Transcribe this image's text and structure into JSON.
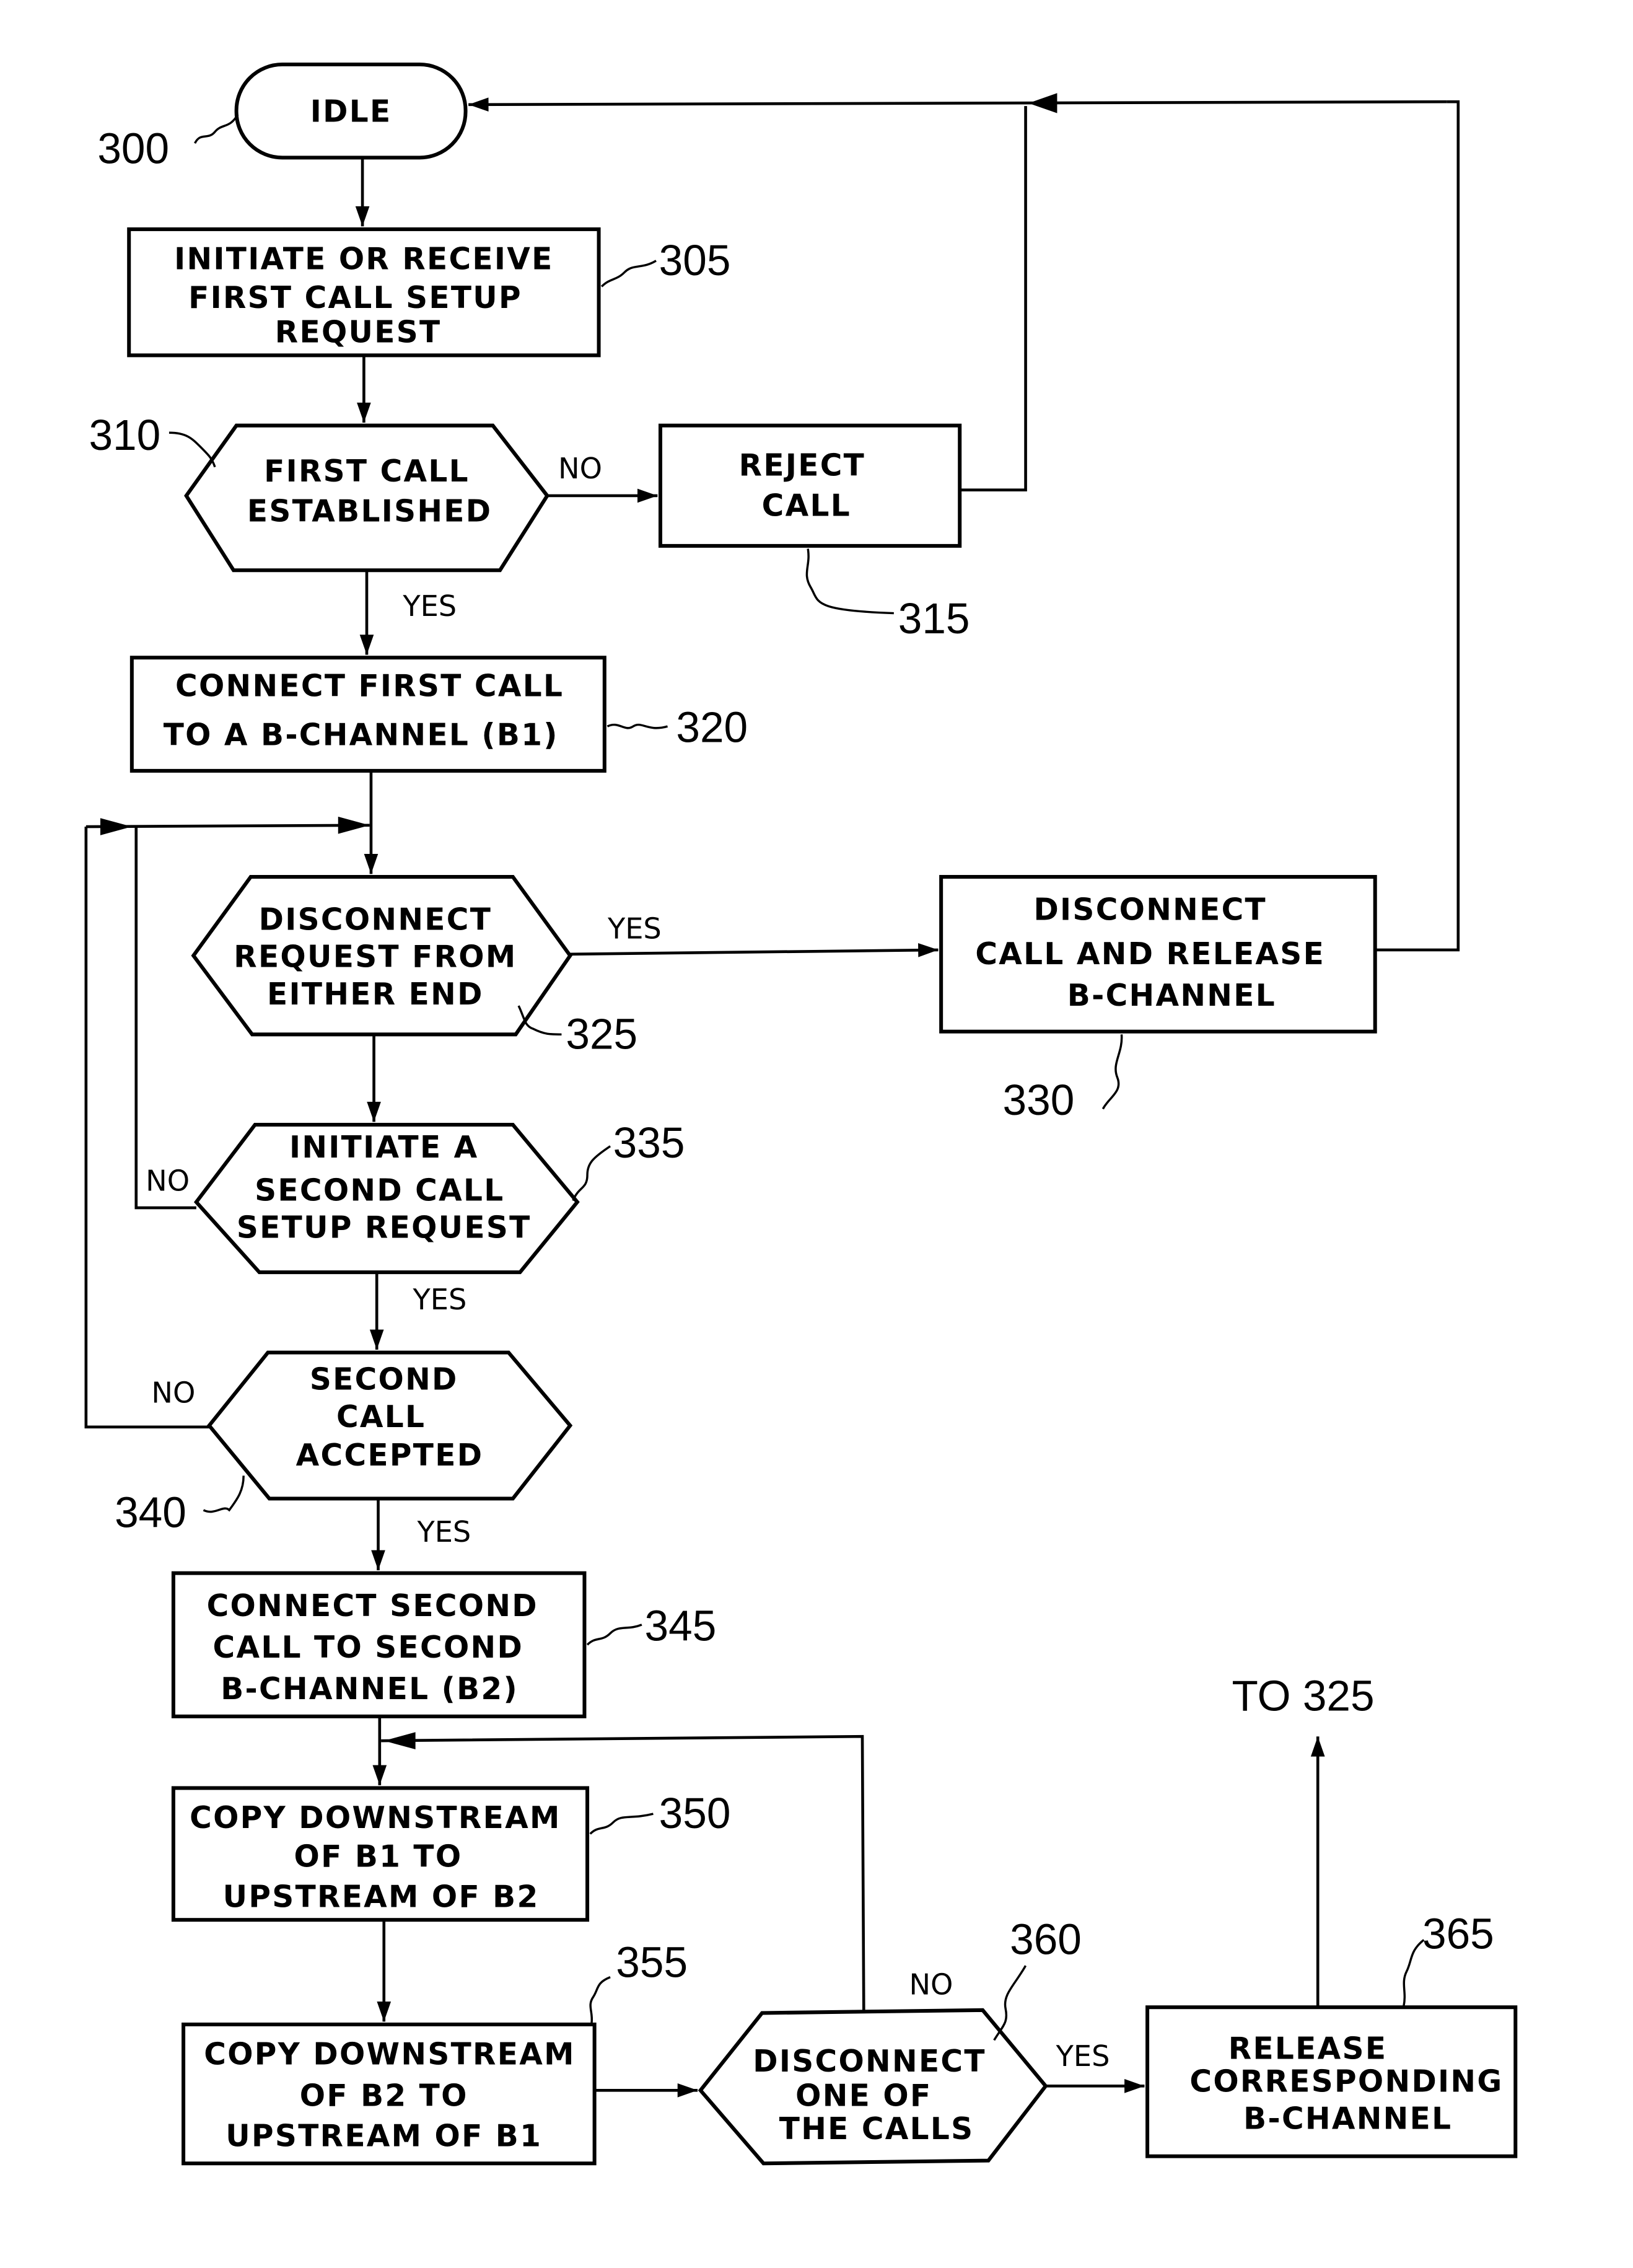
{
  "figure": {
    "type": "flowchart",
    "nodes": [
      {
        "id": "300",
        "shape": "terminal",
        "lines": [
          "IDLE"
        ],
        "ref": "300"
      },
      {
        "id": "305",
        "shape": "process",
        "lines": [
          "INITIATE OR RECEIVE",
          "FIRST CALL SETUP",
          "REQUEST"
        ],
        "ref": "305"
      },
      {
        "id": "310",
        "shape": "decision",
        "lines": [
          "FIRST CALL",
          "ESTABLISHED"
        ],
        "ref": "310"
      },
      {
        "id": "315",
        "shape": "process",
        "lines": [
          "REJECT",
          "CALL"
        ],
        "ref": "315"
      },
      {
        "id": "320",
        "shape": "process",
        "lines": [
          "CONNECT FIRST CALL",
          "TO A B-CHANNEL (B1)"
        ],
        "ref": "320"
      },
      {
        "id": "325",
        "shape": "decision",
        "lines": [
          "DISCONNECT",
          "REQUEST FROM",
          "EITHER END"
        ],
        "ref": "325"
      },
      {
        "id": "330",
        "shape": "process",
        "lines": [
          "DISCONNECT",
          "CALL AND RELEASE",
          "B-CHANNEL"
        ],
        "ref": "330"
      },
      {
        "id": "335",
        "shape": "decision",
        "lines": [
          "INITIATE A",
          "SECOND CALL",
          "SETUP REQUEST"
        ],
        "ref": "335"
      },
      {
        "id": "340",
        "shape": "decision",
        "lines": [
          "SECOND",
          "CALL",
          "ACCEPTED"
        ],
        "ref": "340"
      },
      {
        "id": "345",
        "shape": "process",
        "lines": [
          "CONNECT SECOND",
          "CALL TO SECOND",
          "B-CHANNEL (B2)"
        ],
        "ref": "345"
      },
      {
        "id": "350",
        "shape": "process",
        "lines": [
          "COPY DOWNSTREAM",
          "OF B1 TO",
          "UPSTREAM OF B2"
        ],
        "ref": "350"
      },
      {
        "id": "355",
        "shape": "process",
        "lines": [
          "COPY DOWNSTREAM",
          "OF B2 TO",
          "UPSTREAM OF B1"
        ],
        "ref": "355"
      },
      {
        "id": "360",
        "shape": "decision",
        "lines": [
          "DISCONNECT",
          "ONE OF",
          "THE CALLS"
        ],
        "ref": "360"
      },
      {
        "id": "365",
        "shape": "process",
        "lines": [
          "RELEASE",
          "CORRESPONDING",
          "B-CHANNEL"
        ],
        "ref": "365"
      }
    ],
    "edges": [
      {
        "from": "300",
        "to": "305",
        "label": ""
      },
      {
        "from": "305",
        "to": "310",
        "label": ""
      },
      {
        "from": "310",
        "to": "315",
        "label": "NO"
      },
      {
        "from": "310",
        "to": "320",
        "label": "YES"
      },
      {
        "from": "315",
        "to": "300",
        "label": ""
      },
      {
        "from": "320",
        "to": "325",
        "label": ""
      },
      {
        "from": "325",
        "to": "330",
        "label": "YES"
      },
      {
        "from": "325",
        "to": "335",
        "label": ""
      },
      {
        "from": "330",
        "to": "300",
        "label": ""
      },
      {
        "from": "335",
        "to": "325",
        "label": "NO"
      },
      {
        "from": "335",
        "to": "340",
        "label": "YES"
      },
      {
        "from": "340",
        "to": "325",
        "label": "NO"
      },
      {
        "from": "340",
        "to": "345",
        "label": "YES"
      },
      {
        "from": "345",
        "to": "350",
        "label": ""
      },
      {
        "from": "350",
        "to": "355",
        "label": ""
      },
      {
        "from": "355",
        "to": "360",
        "label": ""
      },
      {
        "from": "360",
        "to": "350",
        "label": "NO"
      },
      {
        "from": "360",
        "to": "365",
        "label": "YES"
      },
      {
        "from": "365",
        "to": "325",
        "label": "TO 325"
      }
    ],
    "labels": {
      "yes": "YES",
      "no": "NO",
      "offpage": "TO 325"
    }
  }
}
